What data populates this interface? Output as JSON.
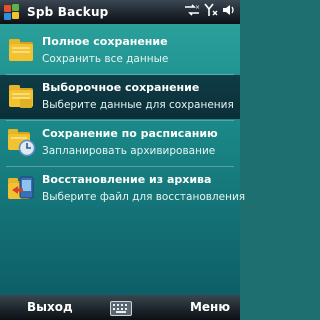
{
  "app": {
    "title": "Spb Backup"
  },
  "status": {
    "icons": [
      "connectivity-icon",
      "no-signal-icon",
      "volume-icon"
    ]
  },
  "menu": {
    "items": [
      {
        "title": "Полное сохранение",
        "subtitle": "Сохранить все данные",
        "icon": "folder-icon",
        "selected": false
      },
      {
        "title": "Выборочное сохранение",
        "subtitle": "Выберите данные для сохранения",
        "icon": "folder-icon",
        "selected": true
      },
      {
        "title": "Сохранение по расписанию",
        "subtitle": "Запланировать архивирование",
        "icon": "folder-clock-icon",
        "selected": false
      },
      {
        "title": "Восстановление из архива",
        "subtitle": "Выберите файл для восстановления",
        "icon": "folder-restore-icon",
        "selected": false
      }
    ]
  },
  "softkeys": {
    "left": "Выход",
    "right": "Меню"
  },
  "colors": {
    "accent": "#1b8a89",
    "selected": "#0f3c46",
    "folder": "#f2c230"
  }
}
